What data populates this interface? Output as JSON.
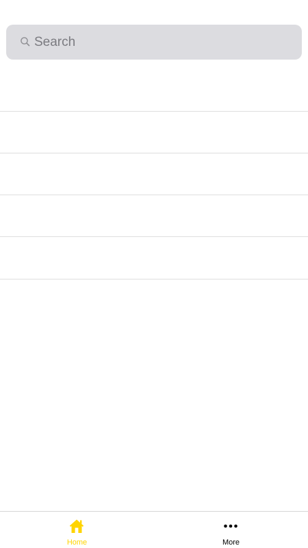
{
  "search": {
    "placeholder": "Search",
    "value": "",
    "icon": "search-icon"
  },
  "list": {
    "items": [
      {
        "label": ""
      },
      {
        "label": ""
      },
      {
        "label": ""
      },
      {
        "label": ""
      },
      {
        "label": ""
      }
    ]
  },
  "tab_bar": {
    "tabs": [
      {
        "label": "Home",
        "icon": "home-icon",
        "active": true,
        "color": "#FFD400"
      },
      {
        "label": "More",
        "icon": "more-icon",
        "active": false,
        "color": "#000000"
      }
    ]
  },
  "colors": {
    "accent": "#FFD400",
    "search_background": "#DCDCE0",
    "separator": "#DEDEDE"
  }
}
